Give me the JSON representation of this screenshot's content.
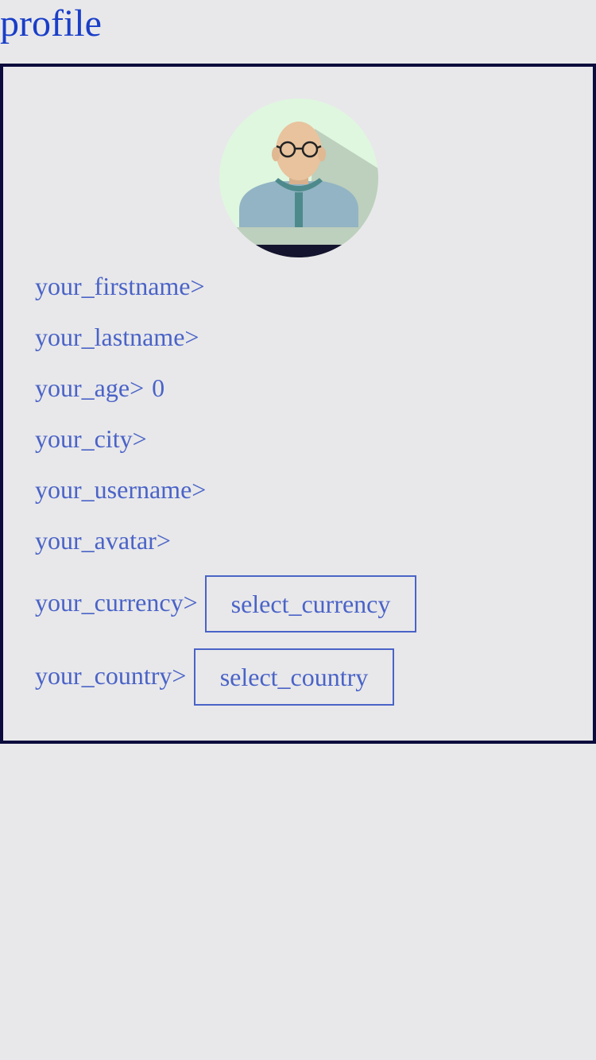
{
  "page": {
    "title": "profile"
  },
  "profile": {
    "avatar_icon": "user-avatar-icon",
    "fields": {
      "firstname_label": "your_firstname>",
      "lastname_label": "your_lastname>",
      "age_label": "your_age>",
      "age_value": "0",
      "city_label": "your_city>",
      "username_label": "your_username>",
      "avatar_label": "your_avatar>",
      "currency_label": "your_currency>",
      "currency_button": "select_currency",
      "country_label": "your_country>",
      "country_button": "select_country"
    }
  },
  "colors": {
    "background": "#e8e8ea",
    "title": "#1a3ec8",
    "text": "#4a63c7",
    "card_border": "#0b0b3d"
  }
}
